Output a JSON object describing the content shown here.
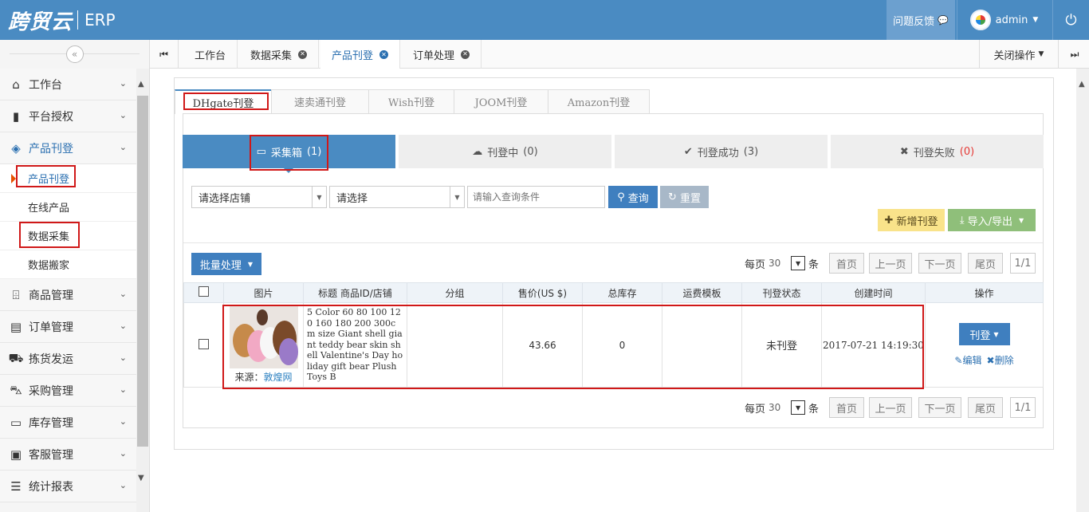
{
  "app": {
    "brand": "跨贸云",
    "module": "ERP"
  },
  "topbar": {
    "feedback": "问题反馈",
    "user": "admin"
  },
  "sidebar": {
    "collapse_icon": "«",
    "items": [
      {
        "label": "工作台",
        "icon": "home-icon"
      },
      {
        "label": "平台授权",
        "icon": "bookmark-icon"
      },
      {
        "label": "产品刊登",
        "icon": "cube-icon",
        "open": true,
        "children": [
          "产品刊登",
          "在线产品",
          "数据采集",
          "数据搬家"
        ]
      },
      {
        "label": "商品管理",
        "icon": "gift-icon"
      },
      {
        "label": "订单管理",
        "icon": "file-icon"
      },
      {
        "label": "拣货发运",
        "icon": "truck-icon"
      },
      {
        "label": "采购管理",
        "icon": "cart-icon"
      },
      {
        "label": "库存管理",
        "icon": "inbox-icon"
      },
      {
        "label": "客服管理",
        "icon": "briefcase-icon"
      },
      {
        "label": "统计报表",
        "icon": "list-icon"
      }
    ]
  },
  "tabs": {
    "items": [
      "工作台",
      "数据采集",
      "产品刊登",
      "订单处理"
    ],
    "active": "产品刊登",
    "close_ops": "关闭操作"
  },
  "platform_tabs": [
    "DHgate刊登",
    "速卖通刊登",
    "Wish刊登",
    "JOOM刊登",
    "Amazon刊登"
  ],
  "status_tabs": [
    {
      "label": "采集箱",
      "count": "(1)"
    },
    {
      "label": "刊登中",
      "count": "(0)"
    },
    {
      "label": "刊登成功",
      "count": "(3)"
    },
    {
      "label": "刊登失败",
      "count": "(0)"
    }
  ],
  "filter": {
    "store_placeholder": "请选择店铺",
    "select_placeholder": "请选择",
    "query_placeholder": "请输入查询条件",
    "search_btn": "查询",
    "reset_btn": "重置"
  },
  "actions": {
    "add": "新增刊登",
    "import_export": "导入/导出",
    "batch": "批量处理"
  },
  "pager": {
    "per_page_label": "每页",
    "per_page": "30",
    "unit": "条",
    "first": "首页",
    "prev": "上一页",
    "next": "下一页",
    "last": "尾页",
    "page": "1/1"
  },
  "table": {
    "headers": [
      "",
      "图片",
      "标题 商品ID/店铺",
      "分组",
      "售价(US $)",
      "总库存",
      "运费模板",
      "刊登状态",
      "创建时间",
      "操作"
    ],
    "rows": [
      {
        "source_label": "来源：",
        "source": "敦煌网",
        "title": "5 Color 60 80 100 120 160 180 200 300cm size Giant shell giant teddy bear skin shell Valentine's Day holiday gift bear Plush Toys B",
        "group": "",
        "price": "43.66",
        "stock": "0",
        "shipping": "",
        "status": "未刊登",
        "created": "2017-07-21 14:19:30",
        "op_btn": "刊登",
        "edit": "编辑",
        "delete": "删除"
      }
    ]
  },
  "colors": {
    "primary": "#4a8bc2",
    "highlight": "#d01818"
  }
}
